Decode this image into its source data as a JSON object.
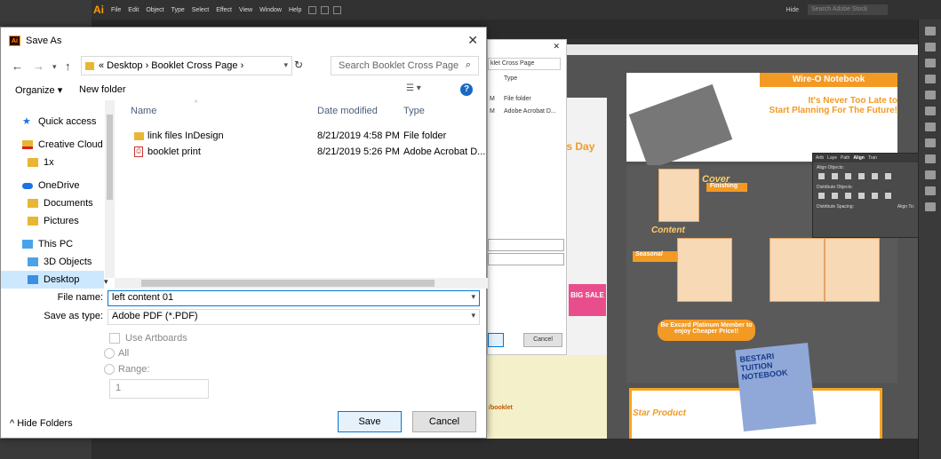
{
  "illustrator": {
    "logo": "Ai",
    "menu": [
      "File",
      "Edit",
      "Object",
      "Type",
      "Select",
      "Effect",
      "View",
      "Window",
      "Help"
    ],
    "search_placeholder": "Search Adobe Stock",
    "layout_mode": "Hide",
    "align_panel": {
      "tabs": [
        "Artb",
        "Laye",
        "Path",
        "Align",
        "Tran"
      ],
      "align_objects": "Align Objects:",
      "distribute_objects": "Distribute Objects:",
      "distribute_spacing": "Distribute Spacing:",
      "align_to": "Align To:"
    },
    "artboard": {
      "header": "Wire-O Notebook",
      "slogan_1": "It's Never Too Late to",
      "slogan_2": "Start Planning For The Future!",
      "cover_label": "Cover",
      "finishing_label": "Finishing",
      "content_label": "Content",
      "seasonal_label": "Seasonal",
      "platinum": "Be Excard Platinum Member to enjoy Cheaper Price!!",
      "star_product": "Star Product",
      "notebook_title": "BESTARI TUITION NOTEBOOK",
      "left_snippet": "/booklet",
      "process_day": "ocess Day",
      "big_sale": "BIG SALE"
    }
  },
  "bg_dialog": {
    "close": "✕",
    "address": "klet Cross Page",
    "col_type": "Type",
    "rows": [
      {
        "m": "M",
        "type": "File folder"
      },
      {
        "m": "M",
        "type": "Adobe Acrobat D..."
      }
    ],
    "cancel": "Cancel"
  },
  "save_dialog": {
    "title": "Save As",
    "close": "✕",
    "breadcrumb": "«  Desktop  ›  Booklet Cross Page  ›",
    "search_placeholder": "Search Booklet Cross Page",
    "organize": "Organize ▾",
    "new_folder": "New folder",
    "help": "?",
    "nav": [
      {
        "label": "Quick access",
        "icon": "star-icon"
      },
      {
        "label": "Creative Cloud Files",
        "icon": "creative-cloud-icon"
      },
      {
        "label": "1x",
        "icon": "folder-icon"
      },
      {
        "label": "OneDrive",
        "icon": "cloud-icon"
      },
      {
        "label": "Documents",
        "icon": "folder-icon"
      },
      {
        "label": "Pictures",
        "icon": "folder-icon"
      },
      {
        "label": "This PC",
        "icon": "computer-icon"
      },
      {
        "label": "3D Objects",
        "icon": "cube-icon"
      },
      {
        "label": "Desktop",
        "icon": "folder-icon"
      }
    ],
    "columns": {
      "name": "Name",
      "date": "Date modified",
      "type": "Type"
    },
    "files": [
      {
        "name": "link files InDesign",
        "date": "8/21/2019 4:58 PM",
        "type": "File folder",
        "icon": "folder-icon"
      },
      {
        "name": "booklet print",
        "date": "8/21/2019 5:26 PM",
        "type": "Adobe Acrobat D...",
        "icon": "pdf-icon"
      }
    ],
    "file_name_label": "File name:",
    "file_name_value": "left content 01",
    "save_as_type_label": "Save as type:",
    "save_as_type_value": "Adobe PDF (*.PDF)",
    "use_artboards": "Use Artboards",
    "all": "All",
    "range": "Range:",
    "range_value": "1",
    "hide_folders": "Hide Folders",
    "save": "Save",
    "cancel": "Cancel"
  },
  "colors": {
    "accent": "#0078d7",
    "ai_orange": "#f39a24",
    "selected_nav": "#cce8ff"
  }
}
